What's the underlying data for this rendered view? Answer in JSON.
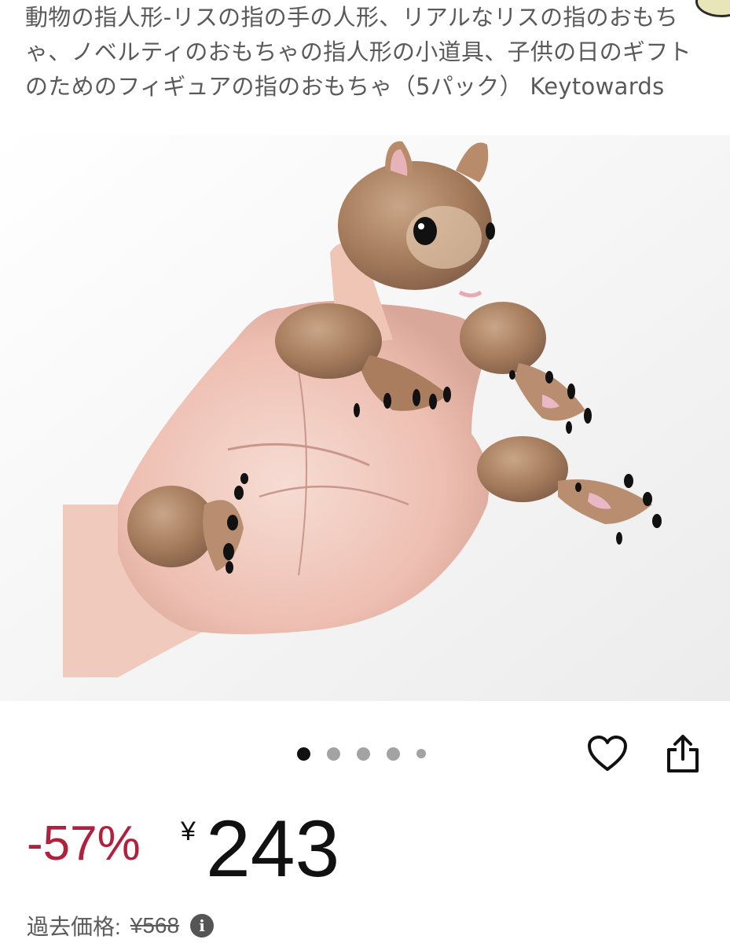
{
  "product": {
    "title": "動物の指人形-リスの指の手の人形、リアルなリスの指のおもちゃ、ノベルティのおもちゃの指人形の小道具、子供の日のギフトのためのフィギュアの指のおもちゃ（5パック） Keytowards",
    "image_alt": "squirrel finger puppets on a hand"
  },
  "gallery": {
    "dot_count": 5,
    "active_index": 0
  },
  "actions": {
    "wishlist_icon": "heart-outline-icon",
    "share_icon": "share-icon"
  },
  "pricing": {
    "discount": "-57%",
    "currency_symbol": "¥",
    "price": "243",
    "past_price_label": "過去価格:",
    "past_price": "¥568",
    "info_icon": "info-icon"
  },
  "colors": {
    "discount": "#b1203d",
    "text": "#111111",
    "muted": "#5a5a5a"
  }
}
